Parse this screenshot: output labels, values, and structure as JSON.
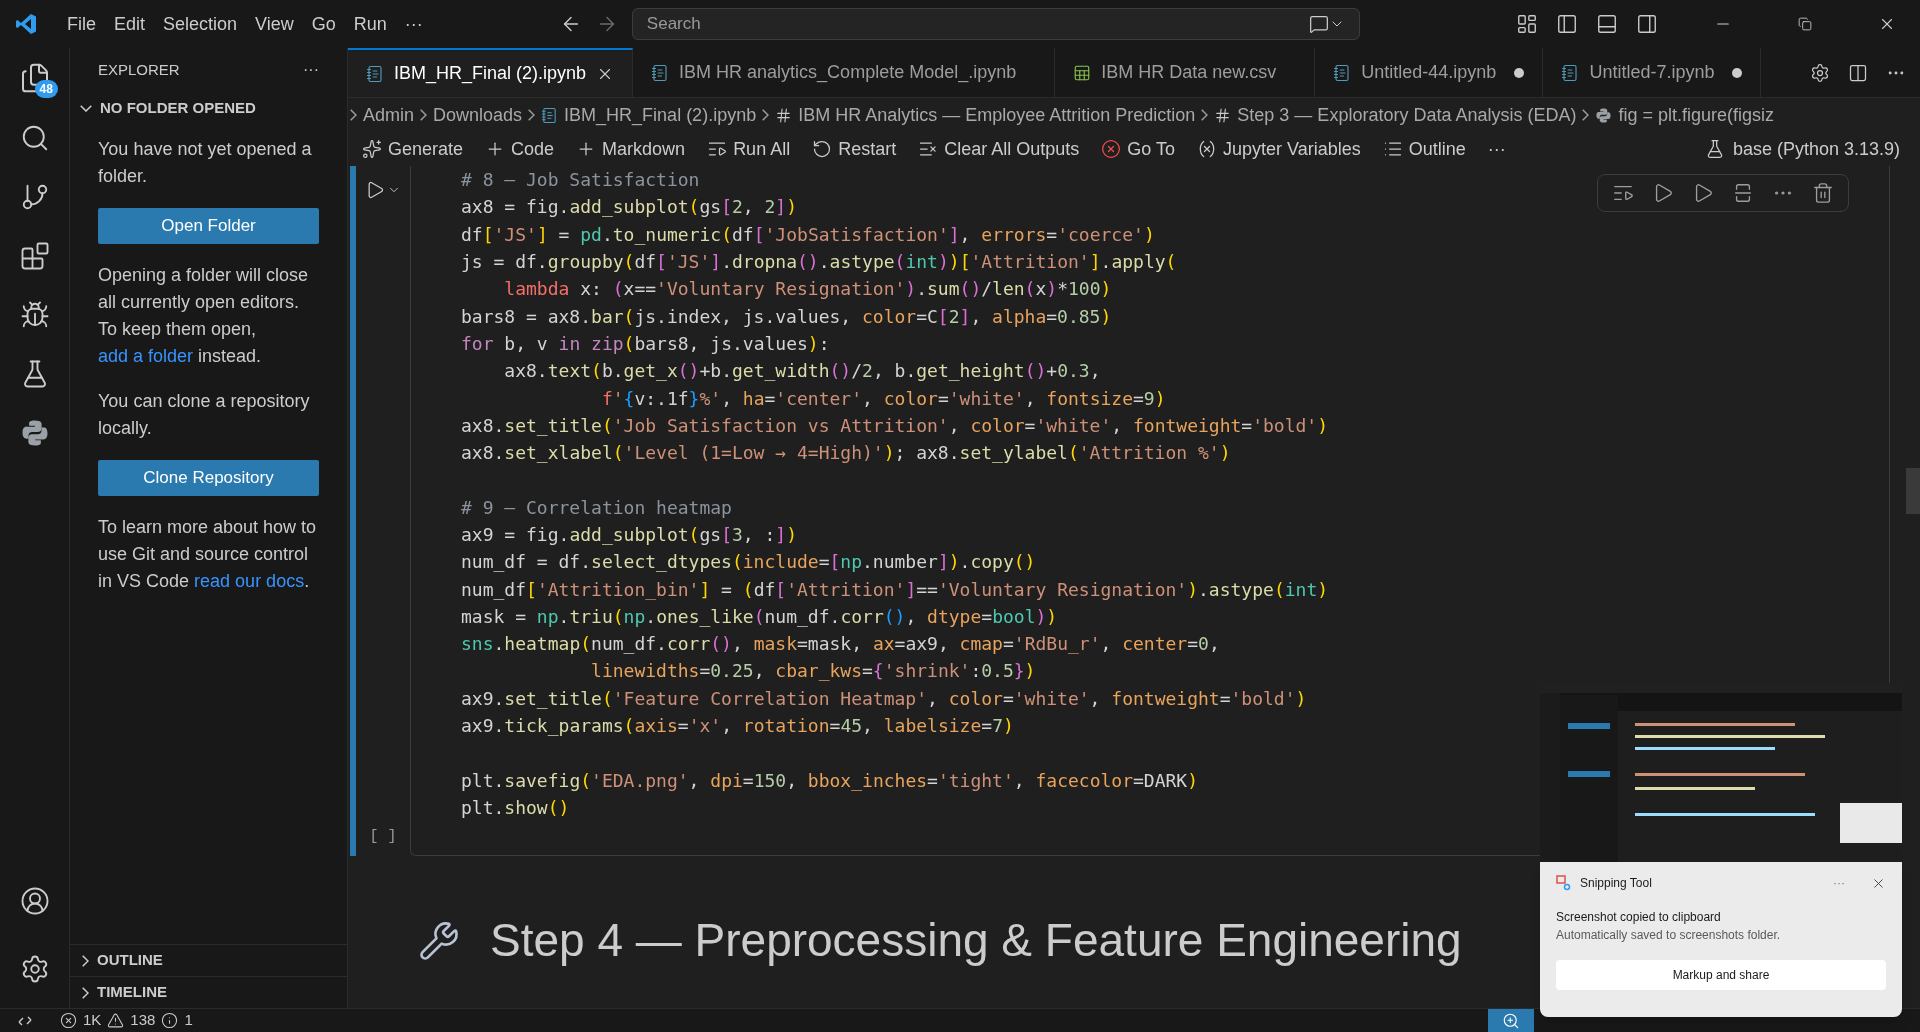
{
  "title_bar": {
    "menu": [
      "File",
      "Edit",
      "Selection",
      "View",
      "Go",
      "Run",
      "···"
    ],
    "search": {
      "placeholder": "Search"
    }
  },
  "activity_bar": {
    "badge": "48"
  },
  "sidebar": {
    "title": "EXPLORER",
    "more": "···",
    "section": {
      "title": "NO FOLDER OPENED",
      "expanded": true
    },
    "blocks": [
      {
        "kind": "text",
        "text": "You have not yet opened a folder."
      },
      {
        "kind": "button",
        "label": "Open Folder"
      },
      {
        "kind": "text",
        "text": "Opening a folder will close all currently open editors. To keep them open,",
        "link": "add a folder",
        "after": "instead."
      },
      {
        "kind": "text",
        "text": "You can clone a repository locally."
      },
      {
        "kind": "button",
        "label": "Clone Repository"
      },
      {
        "kind": "text",
        "text": "To learn more about how to use Git and source control in VS Code",
        "link": "read our docs",
        "after": "."
      }
    ],
    "panels": [
      {
        "title": "OUTLINE",
        "expanded": false
      },
      {
        "title": "TIMELINE",
        "expanded": false
      }
    ]
  },
  "tabs": [
    {
      "label": "IBM_HR_Final (2).ipynb",
      "kind": "notebook",
      "selected": true,
      "dirty": false
    },
    {
      "label": "IBM HR analytics_Complete Model_.ipynb",
      "kind": "notebook",
      "selected": false,
      "dirty": false
    },
    {
      "label": "IBM HR Data new.csv",
      "kind": "csv",
      "selected": false,
      "dirty": false
    },
    {
      "label": "Untitled-44.ipynb",
      "kind": "notebook",
      "selected": false,
      "dirty": true
    },
    {
      "label": "Untitled-7.ipynb",
      "kind": "notebook",
      "selected": false,
      "dirty": true
    }
  ],
  "breadcrumb": [
    {
      "label": "Admin",
      "kind": "folder"
    },
    {
      "label": "Downloads",
      "kind": "folder"
    },
    {
      "label": "IBM_HR_Final (2).ipynb",
      "kind": "notebook"
    },
    {
      "label": "IBM HR Analytics — Employee Attrition Prediction",
      "kind": "markdown"
    },
    {
      "label": "Step 3 — Exploratory Data Analysis (EDA)",
      "kind": "markdown"
    },
    {
      "label": "fig = plt.figure(figsiz",
      "kind": "code"
    }
  ],
  "toolbar": {
    "actions": [
      {
        "label": "Generate",
        "kind": "generate"
      },
      {
        "label": "Code",
        "kind": "add"
      },
      {
        "label": "Markdown",
        "kind": "add"
      },
      {
        "label": "Run All",
        "kind": "run"
      },
      {
        "label": "Restart",
        "kind": "restart"
      },
      {
        "label": "Clear All Outputs",
        "kind": "clear"
      },
      {
        "label": "Go To",
        "kind": "goto"
      },
      {
        "label": "Jupyter Variables",
        "kind": "variables"
      },
      {
        "label": "Outline",
        "kind": "outline"
      }
    ],
    "more": "···",
    "kernel": "base (Python 3.13.9)"
  },
  "cell": {
    "execution": "[ ]",
    "blocks": [
      {
        "lines": [
          [
            {
              "kind": "comment",
              "text": "# 8 — Job Satisfaction"
            }
          ],
          [
            {
              "kind": "plain",
              "text": "ax8 = fig."
            },
            {
              "kind": "fn",
              "text": "add_subplot"
            },
            {
              "kind": "br1",
              "text": "("
            },
            {
              "kind": "plain",
              "text": "gs"
            },
            {
              "kind": "br2",
              "text": "["
            },
            {
              "kind": "num",
              "text": "2"
            },
            {
              "kind": "plain",
              "text": ", "
            },
            {
              "kind": "num",
              "text": "2"
            },
            {
              "kind": "br2",
              "text": "]"
            },
            {
              "kind": "br1",
              "text": ")"
            }
          ],
          [
            {
              "kind": "plain",
              "text": "df"
            },
            {
              "kind": "br1",
              "text": "["
            },
            {
              "kind": "str",
              "text": "'JS'"
            },
            {
              "kind": "br1",
              "text": "]"
            },
            {
              "kind": "plain",
              "text": " = "
            },
            {
              "kind": "mod",
              "text": "pd"
            },
            {
              "kind": "plain",
              "text": "."
            },
            {
              "kind": "fn",
              "text": "to_numeric"
            },
            {
              "kind": "br1",
              "text": "("
            },
            {
              "kind": "plain",
              "text": "df"
            },
            {
              "kind": "br2",
              "text": "["
            },
            {
              "kind": "str",
              "text": "'JobSatisfaction'"
            },
            {
              "kind": "br2",
              "text": "]"
            },
            {
              "kind": "plain",
              "text": ", "
            },
            {
              "kind": "arg",
              "text": "errors"
            },
            {
              "kind": "plain",
              "text": "="
            },
            {
              "kind": "str",
              "text": "'coerce'"
            },
            {
              "kind": "br1",
              "text": ")"
            }
          ],
          [
            {
              "kind": "plain",
              "text": "js = df."
            },
            {
              "kind": "fn",
              "text": "groupby"
            },
            {
              "kind": "br1",
              "text": "("
            },
            {
              "kind": "plain",
              "text": "df"
            },
            {
              "kind": "br2",
              "text": "["
            },
            {
              "kind": "str",
              "text": "'JS'"
            },
            {
              "kind": "br2",
              "text": "]"
            },
            {
              "kind": "plain",
              "text": "."
            },
            {
              "kind": "fn",
              "text": "dropna"
            },
            {
              "kind": "br2",
              "text": "()"
            },
            {
              "kind": "plain",
              "text": "."
            },
            {
              "kind": "fn",
              "text": "astype"
            },
            {
              "kind": "br2",
              "text": "("
            },
            {
              "kind": "mod",
              "text": "int"
            },
            {
              "kind": "br2",
              "text": ")"
            },
            {
              "kind": "br1",
              "text": ")"
            },
            {
              "kind": "br1",
              "text": "["
            },
            {
              "kind": "str",
              "text": "'Attrition'"
            },
            {
              "kind": "br1",
              "text": "]"
            },
            {
              "kind": "plain",
              "text": "."
            },
            {
              "kind": "fn",
              "text": "apply"
            },
            {
              "kind": "br1",
              "text": "("
            }
          ],
          [
            {
              "kind": "kw2",
              "text": "    lambda"
            },
            {
              "kind": "plain",
              "text": " x: "
            },
            {
              "kind": "br2",
              "text": "("
            },
            {
              "kind": "plain",
              "text": "x=="
            },
            {
              "kind": "str",
              "text": "'Voluntary Resignation'"
            },
            {
              "kind": "br2",
              "text": ")"
            },
            {
              "kind": "plain",
              "text": "."
            },
            {
              "kind": "fn",
              "text": "sum"
            },
            {
              "kind": "br2",
              "text": "()"
            },
            {
              "kind": "plain",
              "text": "/"
            },
            {
              "kind": "fn",
              "text": "len"
            },
            {
              "kind": "br2",
              "text": "("
            },
            {
              "kind": "plain",
              "text": "x"
            },
            {
              "kind": "br2",
              "text": ")"
            },
            {
              "kind": "plain",
              "text": "*"
            },
            {
              "kind": "num",
              "text": "100"
            },
            {
              "kind": "br1",
              "text": ")"
            }
          ],
          [
            {
              "kind": "plain",
              "text": "bars8 = ax8."
            },
            {
              "kind": "fn",
              "text": "bar"
            },
            {
              "kind": "br1",
              "text": "("
            },
            {
              "kind": "plain",
              "text": "js.index, js.values, "
            },
            {
              "kind": "arg",
              "text": "color"
            },
            {
              "kind": "plain",
              "text": "=C"
            },
            {
              "kind": "br2",
              "text": "["
            },
            {
              "kind": "num",
              "text": "2"
            },
            {
              "kind": "br2",
              "text": "]"
            },
            {
              "kind": "plain",
              "text": ", "
            },
            {
              "kind": "arg",
              "text": "alpha"
            },
            {
              "kind": "plain",
              "text": "="
            },
            {
              "kind": "num",
              "text": "0.85"
            },
            {
              "kind": "br1",
              "text": ")"
            }
          ],
          [
            {
              "kind": "kw",
              "text": "for"
            },
            {
              "kind": "plain",
              "text": " b, v "
            },
            {
              "kind": "kw",
              "text": "in"
            },
            {
              "kind": "kw",
              "text": " zip"
            },
            {
              "kind": "br1",
              "text": "("
            },
            {
              "kind": "plain",
              "text": "bars8, js.values"
            },
            {
              "kind": "br1",
              "text": ")"
            },
            {
              "kind": "plain",
              "text": ":"
            }
          ],
          [
            {
              "kind": "plain",
              "text": "    ax8."
            },
            {
              "kind": "fn",
              "text": "text"
            },
            {
              "kind": "br1",
              "text": "("
            },
            {
              "kind": "plain",
              "text": "b."
            },
            {
              "kind": "fn",
              "text": "get_x"
            },
            {
              "kind": "br2",
              "text": "()"
            },
            {
              "kind": "plain",
              "text": "+b."
            },
            {
              "kind": "fn",
              "text": "get_width"
            },
            {
              "kind": "br2",
              "text": "()"
            },
            {
              "kind": "plain",
              "text": "/"
            },
            {
              "kind": "num",
              "text": "2"
            },
            {
              "kind": "plain",
              "text": ", b."
            },
            {
              "kind": "fn",
              "text": "get_height"
            },
            {
              "kind": "br2",
              "text": "()"
            },
            {
              "kind": "plain",
              "text": "+"
            },
            {
              "kind": "num",
              "text": "0.3"
            },
            {
              "kind": "plain",
              "text": ","
            }
          ],
          [
            {
              "kind": "kw2",
              "text": "             f"
            },
            {
              "kind": "str",
              "text": "'"
            },
            {
              "kind": "br3",
              "text": "{"
            },
            {
              "kind": "plain",
              "text": "v:.1f"
            },
            {
              "kind": "br3",
              "text": "}"
            },
            {
              "kind": "str",
              "text": "%'"
            },
            {
              "kind": "plain",
              "text": ", "
            },
            {
              "kind": "arg",
              "text": "ha"
            },
            {
              "kind": "plain",
              "text": "="
            },
            {
              "kind": "str",
              "text": "'center'"
            },
            {
              "kind": "plain",
              "text": ", "
            },
            {
              "kind": "arg",
              "text": "color"
            },
            {
              "kind": "plain",
              "text": "="
            },
            {
              "kind": "str",
              "text": "'white'"
            },
            {
              "kind": "plain",
              "text": ", "
            },
            {
              "kind": "arg",
              "text": "fontsize"
            },
            {
              "kind": "plain",
              "text": "="
            },
            {
              "kind": "num",
              "text": "9"
            },
            {
              "kind": "br1",
              "text": ")"
            }
          ],
          [
            {
              "kind": "plain",
              "text": "ax8."
            },
            {
              "kind": "fn",
              "text": "set_title"
            },
            {
              "kind": "br1",
              "text": "("
            },
            {
              "kind": "str",
              "text": "'Job Satisfaction vs Attrition'"
            },
            {
              "kind": "plain",
              "text": ", "
            },
            {
              "kind": "arg",
              "text": "color"
            },
            {
              "kind": "plain",
              "text": "="
            },
            {
              "kind": "str",
              "text": "'white'"
            },
            {
              "kind": "plain",
              "text": ", "
            },
            {
              "kind": "arg",
              "text": "fontweight"
            },
            {
              "kind": "plain",
              "text": "="
            },
            {
              "kind": "str",
              "text": "'bold'"
            },
            {
              "kind": "br1",
              "text": ")"
            }
          ],
          [
            {
              "kind": "plain",
              "text": "ax8."
            },
            {
              "kind": "fn",
              "text": "set_xlabel"
            },
            {
              "kind": "br1",
              "text": "("
            },
            {
              "kind": "str",
              "text": "'Level (1=Low → 4=High)'"
            },
            {
              "kind": "br1",
              "text": ")"
            },
            {
              "kind": "plain",
              "text": "; ax8."
            },
            {
              "kind": "fn",
              "text": "set_ylabel"
            },
            {
              "kind": "br1",
              "text": "("
            },
            {
              "kind": "str",
              "text": "'Attrition %'"
            },
            {
              "kind": "br1",
              "text": ")"
            }
          ]
        ]
      },
      {
        "lines": [
          [
            {
              "kind": "comment",
              "text": "# 9 — Correlation heatmap"
            }
          ],
          [
            {
              "kind": "plain",
              "text": "ax9 = fig."
            },
            {
              "kind": "fn",
              "text": "add_subplot"
            },
            {
              "kind": "br1",
              "text": "("
            },
            {
              "kind": "plain",
              "text": "gs"
            },
            {
              "kind": "br2",
              "text": "["
            },
            {
              "kind": "num",
              "text": "3"
            },
            {
              "kind": "plain",
              "text": ", :"
            },
            {
              "kind": "br2",
              "text": "]"
            },
            {
              "kind": "br1",
              "text": ")"
            }
          ],
          [
            {
              "kind": "plain",
              "text": "num_df = df."
            },
            {
              "kind": "fn",
              "text": "select_dtypes"
            },
            {
              "kind": "br1",
              "text": "("
            },
            {
              "kind": "arg",
              "text": "include"
            },
            {
              "kind": "plain",
              "text": "="
            },
            {
              "kind": "br2",
              "text": "["
            },
            {
              "kind": "mod",
              "text": "np"
            },
            {
              "kind": "plain",
              "text": ".number"
            },
            {
              "kind": "br2",
              "text": "]"
            },
            {
              "kind": "br1",
              "text": ")"
            },
            {
              "kind": "plain",
              "text": "."
            },
            {
              "kind": "fn",
              "text": "copy"
            },
            {
              "kind": "br1",
              "text": "()"
            }
          ],
          [
            {
              "kind": "plain",
              "text": "num_df"
            },
            {
              "kind": "br1",
              "text": "["
            },
            {
              "kind": "str",
              "text": "'Attrition_bin'"
            },
            {
              "kind": "br1",
              "text": "]"
            },
            {
              "kind": "plain",
              "text": " = "
            },
            {
              "kind": "br1",
              "text": "("
            },
            {
              "kind": "plain",
              "text": "df"
            },
            {
              "kind": "br2",
              "text": "["
            },
            {
              "kind": "str",
              "text": "'Attrition'"
            },
            {
              "kind": "br2",
              "text": "]"
            },
            {
              "kind": "plain",
              "text": "=="
            },
            {
              "kind": "str",
              "text": "'Voluntary Resignation'"
            },
            {
              "kind": "br1",
              "text": ")"
            },
            {
              "kind": "plain",
              "text": "."
            },
            {
              "kind": "fn",
              "text": "astype"
            },
            {
              "kind": "br1",
              "text": "("
            },
            {
              "kind": "mod",
              "text": "int"
            },
            {
              "kind": "br1",
              "text": ")"
            }
          ],
          [
            {
              "kind": "plain",
              "text": "mask = "
            },
            {
              "kind": "mod",
              "text": "np"
            },
            {
              "kind": "plain",
              "text": "."
            },
            {
              "kind": "fn",
              "text": "triu"
            },
            {
              "kind": "br1",
              "text": "("
            },
            {
              "kind": "mod",
              "text": "np"
            },
            {
              "kind": "plain",
              "text": "."
            },
            {
              "kind": "fn",
              "text": "ones_like"
            },
            {
              "kind": "br2",
              "text": "("
            },
            {
              "kind": "plain",
              "text": "num_df."
            },
            {
              "kind": "fn",
              "text": "corr"
            },
            {
              "kind": "br3",
              "text": "()"
            },
            {
              "kind": "plain",
              "text": ", "
            },
            {
              "kind": "arg",
              "text": "dtype"
            },
            {
              "kind": "plain",
              "text": "="
            },
            {
              "kind": "mod",
              "text": "bool"
            },
            {
              "kind": "br2",
              "text": ")"
            },
            {
              "kind": "br1",
              "text": ")"
            }
          ],
          [
            {
              "kind": "mod",
              "text": "sns"
            },
            {
              "kind": "plain",
              "text": "."
            },
            {
              "kind": "fn",
              "text": "heatmap"
            },
            {
              "kind": "br1",
              "text": "("
            },
            {
              "kind": "plain",
              "text": "num_df."
            },
            {
              "kind": "fn",
              "text": "corr"
            },
            {
              "kind": "br2",
              "text": "()"
            },
            {
              "kind": "plain",
              "text": ", "
            },
            {
              "kind": "arg",
              "text": "mask"
            },
            {
              "kind": "plain",
              "text": "=mask, "
            },
            {
              "kind": "arg",
              "text": "ax"
            },
            {
              "kind": "plain",
              "text": "=ax9, "
            },
            {
              "kind": "arg",
              "text": "cmap"
            },
            {
              "kind": "plain",
              "text": "="
            },
            {
              "kind": "str",
              "text": "'RdBu_r'"
            },
            {
              "kind": "plain",
              "text": ", "
            },
            {
              "kind": "arg",
              "text": "center"
            },
            {
              "kind": "plain",
              "text": "="
            },
            {
              "kind": "num",
              "text": "0"
            },
            {
              "kind": "plain",
              "text": ","
            }
          ],
          [
            {
              "kind": "arg",
              "text": "            linewidths"
            },
            {
              "kind": "plain",
              "text": "="
            },
            {
              "kind": "num",
              "text": "0.25"
            },
            {
              "kind": "plain",
              "text": ", "
            },
            {
              "kind": "arg",
              "text": "cbar_kws"
            },
            {
              "kind": "plain",
              "text": "="
            },
            {
              "kind": "br2",
              "text": "{"
            },
            {
              "kind": "str",
              "text": "'shrink'"
            },
            {
              "kind": "plain",
              "text": ":"
            },
            {
              "kind": "num",
              "text": "0.5"
            },
            {
              "kind": "br2",
              "text": "}"
            },
            {
              "kind": "br1",
              "text": ")"
            }
          ],
          [
            {
              "kind": "plain",
              "text": "ax9."
            },
            {
              "kind": "fn",
              "text": "set_title"
            },
            {
              "kind": "br1",
              "text": "("
            },
            {
              "kind": "str",
              "text": "'Feature Correlation Heatmap'"
            },
            {
              "kind": "plain",
              "text": ", "
            },
            {
              "kind": "arg",
              "text": "color"
            },
            {
              "kind": "plain",
              "text": "="
            },
            {
              "kind": "str",
              "text": "'white'"
            },
            {
              "kind": "plain",
              "text": ", "
            },
            {
              "kind": "arg",
              "text": "fontweight"
            },
            {
              "kind": "plain",
              "text": "="
            },
            {
              "kind": "str",
              "text": "'bold'"
            },
            {
              "kind": "br1",
              "text": ")"
            }
          ],
          [
            {
              "kind": "plain",
              "text": "ax9."
            },
            {
              "kind": "fn",
              "text": "tick_params"
            },
            {
              "kind": "br1",
              "text": "("
            },
            {
              "kind": "arg",
              "text": "axis"
            },
            {
              "kind": "plain",
              "text": "="
            },
            {
              "kind": "str",
              "text": "'x'"
            },
            {
              "kind": "plain",
              "text": ", "
            },
            {
              "kind": "arg",
              "text": "rotation"
            },
            {
              "kind": "plain",
              "text": "="
            },
            {
              "kind": "num",
              "text": "45"
            },
            {
              "kind": "plain",
              "text": ", "
            },
            {
              "kind": "arg",
              "text": "labelsize"
            },
            {
              "kind": "plain",
              "text": "="
            },
            {
              "kind": "num",
              "text": "7"
            },
            {
              "kind": "br1",
              "text": ")"
            }
          ]
        ]
      },
      {
        "lines": [
          [
            {
              "kind": "plain",
              "text": "plt."
            },
            {
              "kind": "fn",
              "text": "savefig"
            },
            {
              "kind": "br1",
              "text": "("
            },
            {
              "kind": "str",
              "text": "'EDA.png'"
            },
            {
              "kind": "plain",
              "text": ", "
            },
            {
              "kind": "arg",
              "text": "dpi"
            },
            {
              "kind": "plain",
              "text": "="
            },
            {
              "kind": "num",
              "text": "150"
            },
            {
              "kind": "plain",
              "text": ", "
            },
            {
              "kind": "arg",
              "text": "bbox_inches"
            },
            {
              "kind": "plain",
              "text": "="
            },
            {
              "kind": "str",
              "text": "'tight'"
            },
            {
              "kind": "plain",
              "text": ", "
            },
            {
              "kind": "arg",
              "text": "facecolor"
            },
            {
              "kind": "plain",
              "text": "=DARK"
            },
            {
              "kind": "br1",
              "text": ")"
            }
          ],
          [
            {
              "kind": "plain",
              "text": "plt."
            },
            {
              "kind": "fn",
              "text": "show"
            },
            {
              "kind": "br1",
              "text": "()"
            }
          ]
        ]
      }
    ]
  },
  "heading": {
    "text": "Step 4 — Preprocessing & Feature Engineering"
  },
  "status_bar": {
    "errors": "1K",
    "warnings": "138",
    "info": "1"
  },
  "notification": {
    "app": "Snipping Tool",
    "more": "···",
    "title": "Screenshot copied to clipboard",
    "message": "Automatically saved to screenshots folder.",
    "button": "Markup and share"
  }
}
